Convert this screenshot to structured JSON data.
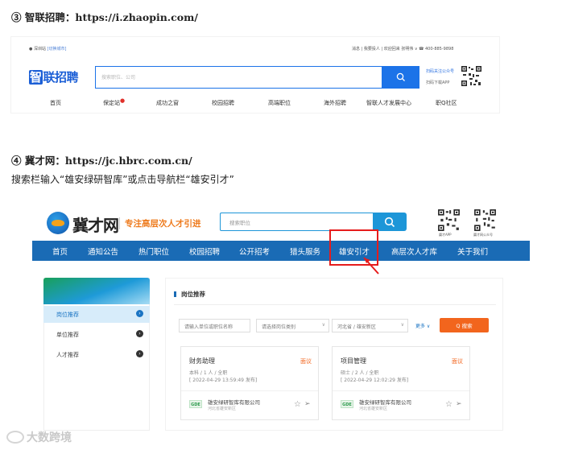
{
  "section3": {
    "heading": "③ 智联招聘：https://i.zhaopin.com/",
    "top_left": "● 深圳站 [切换城市]",
    "top_left_city": "● 深圳站",
    "top_left_switch": "[切换城市]",
    "top_right": "消息 | 我要投人 | 欢迎回来 张明伟 ∨   ☎ 400-885-9898",
    "logo": "智联招聘",
    "logo_mark": "智",
    "logo_rest": "联招聘",
    "search_placeholder": "搜索职位、公司",
    "app_line1": "扫码关注公众号",
    "app_line2": "扫码下载APP",
    "nav": [
      "首页",
      "保定站",
      "成功之窗",
      "校园招聘",
      "高端职位",
      "海外招聘",
      "智联人才发展中心",
      "职Q社区"
    ]
  },
  "section4": {
    "heading": "④ 冀才网：https://jc.hbrc.com.cn/",
    "instruction": "搜索栏输入“雄安绿研智库”或点击导航栏“雄安引才”",
    "logo_text": "冀才网",
    "slogan": "专注高层次人才引进",
    "search_placeholder": "搜索职位",
    "qr_caption1": "冀才APP",
    "qr_caption2": "冀才网公众号",
    "nav": [
      "首页",
      "通知公告",
      "热门职位",
      "校园招聘",
      "公开招考",
      "猎头服务",
      "雄安引才",
      "高层次人才库",
      "关于我们"
    ],
    "sidebar": [
      "岗位推荐",
      "单位推荐",
      "人才推荐"
    ],
    "main_title": "岗位推荐",
    "filter_input": "请输入单位或职位名称",
    "filter_category": "请选择岗位类别",
    "filter_region": "河北省 / 雄安新区",
    "more_label": "更多 ∨",
    "query_label": "Q 搜索",
    "cards": [
      {
        "title": "财务助理",
        "salary": "面议",
        "sub": "本科 / 1 人 / 全职",
        "date": "[ 2022-04-29 13:59:49 发布]",
        "company_logo": "GDE",
        "company": "雄安绿研智库有限公司",
        "company_loc": "河北省雄安新区"
      },
      {
        "title": "项目管理",
        "salary": "面议",
        "sub": "硕士 / 2 人 / 全职",
        "date": "[ 2022-04-29 12:02:29 发布]",
        "company_logo": "GDE",
        "company": "雄安绿研智库有限公司",
        "company_loc": "河北省雄安新区"
      }
    ]
  },
  "watermark": "大数跨境",
  "colors": {
    "zhaopin_blue": "#1c73e8",
    "jicai_nav": "#1a6bb5",
    "jicai_search": "#1d96d8",
    "highlight_red": "#e61c1c",
    "orange": "#f2651d"
  }
}
